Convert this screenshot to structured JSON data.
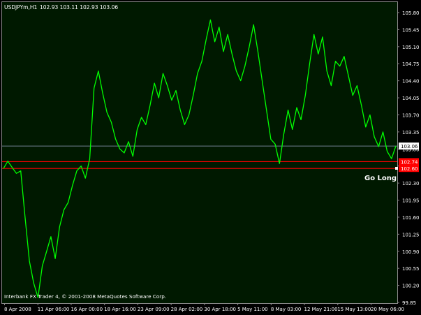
{
  "header": {
    "symbol_text": "USDJPYm,H1",
    "ohlc_text": "102.93 103.11 102.93 103.06"
  },
  "footer": {
    "copyright_text": "Interbank FX Trader 4, © 2001-2008 MetaQuotes Software Corp."
  },
  "annotation": {
    "go_long_text": "Go Long"
  },
  "price_axis": {
    "ticks": [
      "105.80",
      "105.45",
      "105.10",
      "104.75",
      "104.40",
      "104.05",
      "103.70",
      "103.35",
      "103.00",
      "102.65",
      "102.30",
      "101.95",
      "101.60",
      "101.25",
      "100.90",
      "100.55",
      "100.20",
      "99.85"
    ],
    "current_price_label": "103.06",
    "level_labels": [
      "102.74",
      "102.60"
    ]
  },
  "time_axis": {
    "ticks": [
      "8 Apr 2008",
      "11 Apr 06:00",
      "16 Apr 00:00",
      "18 Apr 16:00",
      "23 Apr 09:00",
      "28 Apr 02:00",
      "30 Apr 18:00",
      "5 May 11:00",
      "8 May 03:00",
      "12 May 21:00",
      "15 May 13:00",
      "20 May 06:00"
    ]
  },
  "colors": {
    "background": "#000000",
    "plot_background": "#001900",
    "price_line": "#00ff00",
    "current_price_line": "#6f7f8f",
    "level_line": "#ff0000",
    "text": "#ffffff"
  },
  "chart_data": {
    "type": "line",
    "title": "USDJPYm,H1",
    "xlabel": "",
    "ylabel": "",
    "ylim": [
      99.85,
      105.8
    ],
    "x": [
      "8 Apr 2008",
      "8 Apr 2008",
      "9 Apr",
      "9 Apr",
      "9 Apr",
      "10 Apr",
      "10 Apr",
      "10 Apr",
      "11 Apr 06:00",
      "11 Apr",
      "14 Apr",
      "14 Apr",
      "14 Apr",
      "15 Apr",
      "15 Apr",
      "16 Apr 00:00",
      "16 Apr",
      "16 Apr",
      "17 Apr",
      "17 Apr",
      "17 Apr",
      "18 Apr",
      "18 Apr",
      "18 Apr 16:00",
      "18 Apr",
      "21 Apr",
      "21 Apr",
      "21 Apr",
      "22 Apr",
      "22 Apr",
      "22 Apr",
      "23 Apr 09:00",
      "23 Apr",
      "24 Apr",
      "24 Apr",
      "24 Apr",
      "25 Apr",
      "25 Apr",
      "28 Apr 02:00",
      "28 Apr",
      "28 Apr",
      "29 Apr",
      "29 Apr",
      "29 Apr",
      "30 Apr",
      "30 Apr",
      "30 Apr 18:00",
      "30 Apr",
      "1 May",
      "1 May",
      "1 May",
      "2 May",
      "2 May",
      "2 May",
      "5 May",
      "5 May 11:00",
      "5 May",
      "6 May",
      "6 May",
      "6 May",
      "7 May",
      "7 May",
      "7 May",
      "8 May",
      "8 May 03:00",
      "8 May",
      "9 May",
      "9 May",
      "9 May",
      "12 May",
      "12 May",
      "12 May 21:00",
      "12 May",
      "13 May",
      "13 May",
      "13 May",
      "14 May",
      "14 May",
      "15 May",
      "15 May 13:00",
      "15 May",
      "16 May",
      "16 May",
      "19 May",
      "19 May",
      "19 May",
      "20 May",
      "20 May 06:00",
      "20 May",
      "20 May",
      "21 May",
      "21 May"
    ],
    "series": [
      {
        "values": [
          102.6,
          102.75,
          102.62,
          102.5,
          102.55,
          101.6,
          100.7,
          100.25,
          99.95,
          100.6,
          100.9,
          101.2,
          100.75,
          101.4,
          101.75,
          101.9,
          102.25,
          102.55,
          102.65,
          102.4,
          102.8,
          104.25,
          104.6,
          104.15,
          103.75,
          103.55,
          103.2,
          103.0,
          102.92,
          103.15,
          102.85,
          103.4,
          103.65,
          103.5,
          103.9,
          104.35,
          104.05,
          104.55,
          104.3,
          104.0,
          104.2,
          103.8,
          103.5,
          103.7,
          104.1,
          104.55,
          104.8,
          105.25,
          105.65,
          105.2,
          105.5,
          105.0,
          105.35,
          104.95,
          104.6,
          104.4,
          104.7,
          105.1,
          105.55,
          105.0,
          104.4,
          103.8,
          103.2,
          103.1,
          102.7,
          103.3,
          103.8,
          103.4,
          103.85,
          103.6,
          104.1,
          104.75,
          105.35,
          104.95,
          105.3,
          104.6,
          104.3,
          104.8,
          104.7,
          104.9,
          104.5,
          104.1,
          104.3,
          103.9,
          103.45,
          103.7,
          103.25,
          103.05,
          103.35,
          102.95,
          102.8,
          103.06
        ]
      }
    ],
    "hlines": [
      103.06,
      102.74,
      102.6
    ],
    "grid": false
  }
}
